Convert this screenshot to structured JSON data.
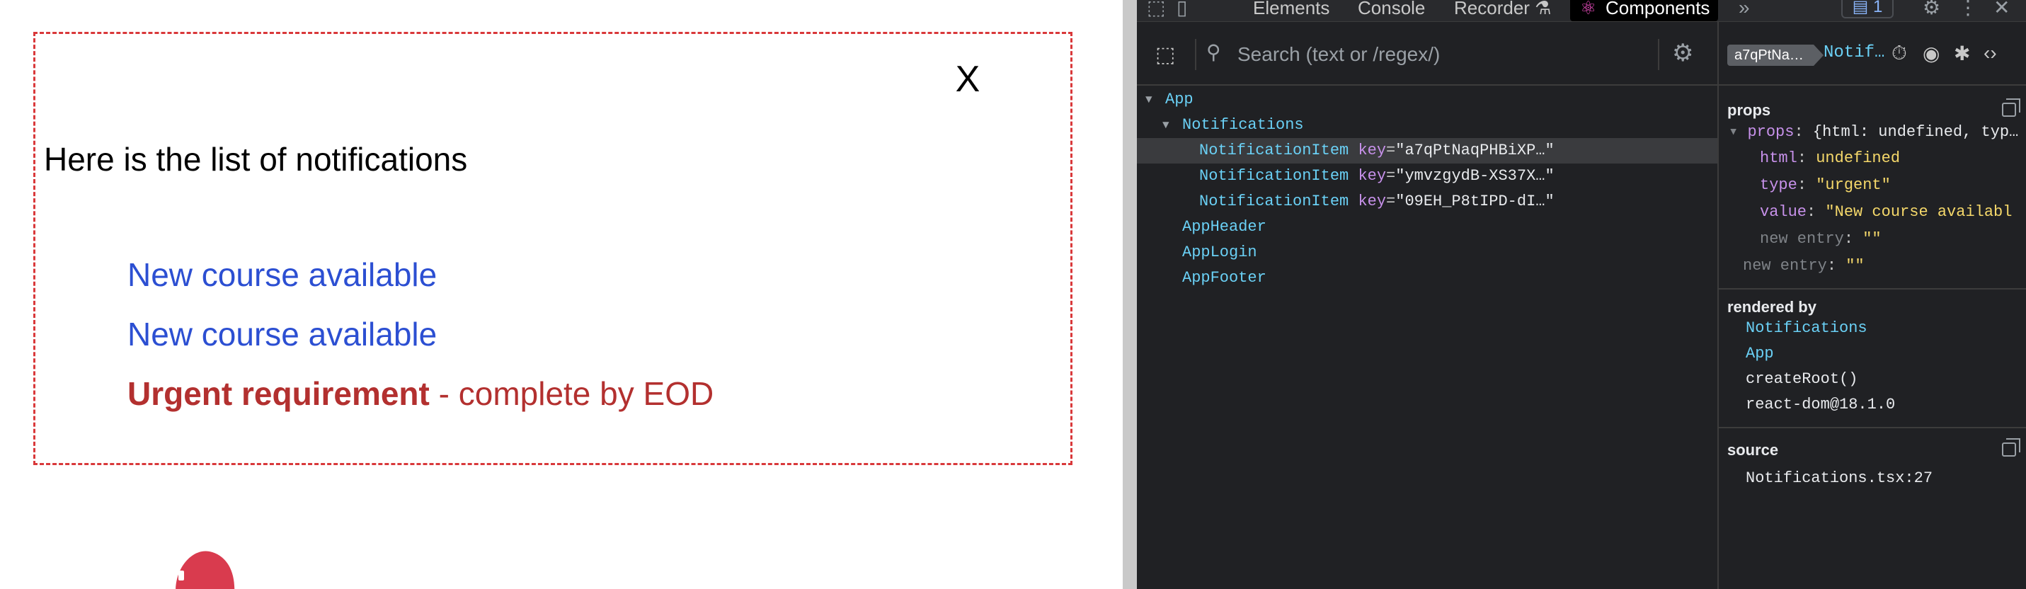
{
  "app": {
    "close_label": "X",
    "heading": "Here is the list of notifications",
    "notifications": [
      {
        "text": "New course available",
        "type": "default"
      },
      {
        "text": "New course available",
        "type": "default"
      },
      {
        "bold": "Urgent requirement",
        "rest": " - complete by EOD",
        "type": "urgent"
      }
    ],
    "colors": {
      "border": "#d9383a",
      "default_text": "#2c4fd2",
      "urgent_text": "#b3302f"
    }
  },
  "devtools": {
    "tabs": [
      "Elements",
      "Console",
      "Recorder",
      "Components"
    ],
    "active_tab": "Components",
    "message_count": "1",
    "search": {
      "placeholder": "Search (text or /regex/)"
    },
    "tree": {
      "app": "App",
      "notifications": "Notifications",
      "items": [
        {
          "name": "NotificationItem",
          "key_attr": "key",
          "key_value": "\"a7qPtNaqPHBiXP…\""
        },
        {
          "name": "NotificationItem",
          "key_attr": "key",
          "key_value": "\"ymvzgydB-XS37X…\""
        },
        {
          "name": "NotificationItem",
          "key_attr": "key",
          "key_value": "\"09EH_P8tIPD-dI…\""
        }
      ],
      "siblings": [
        "AppHeader",
        "AppLogin",
        "AppFooter"
      ]
    },
    "side": {
      "key_badge": "a7qPtNa…",
      "selected_name": "Notif…",
      "props_title": "props",
      "props_summary_key": "props",
      "props_summary": "{html: undefined, typ…",
      "props": [
        {
          "key": "html",
          "value": "undefined"
        },
        {
          "key": "type",
          "value": "\"urgent\""
        },
        {
          "key": "value",
          "value": "\"New course availabl"
        }
      ],
      "new_entry_label": "new entry",
      "new_entry_value": "\"\"",
      "rendered_by_title": "rendered by",
      "rendered_by": [
        "Notifications",
        "App",
        "createRoot()",
        "react-dom@18.1.0"
      ],
      "source_title": "source",
      "source": "Notifications.tsx:27"
    }
  }
}
